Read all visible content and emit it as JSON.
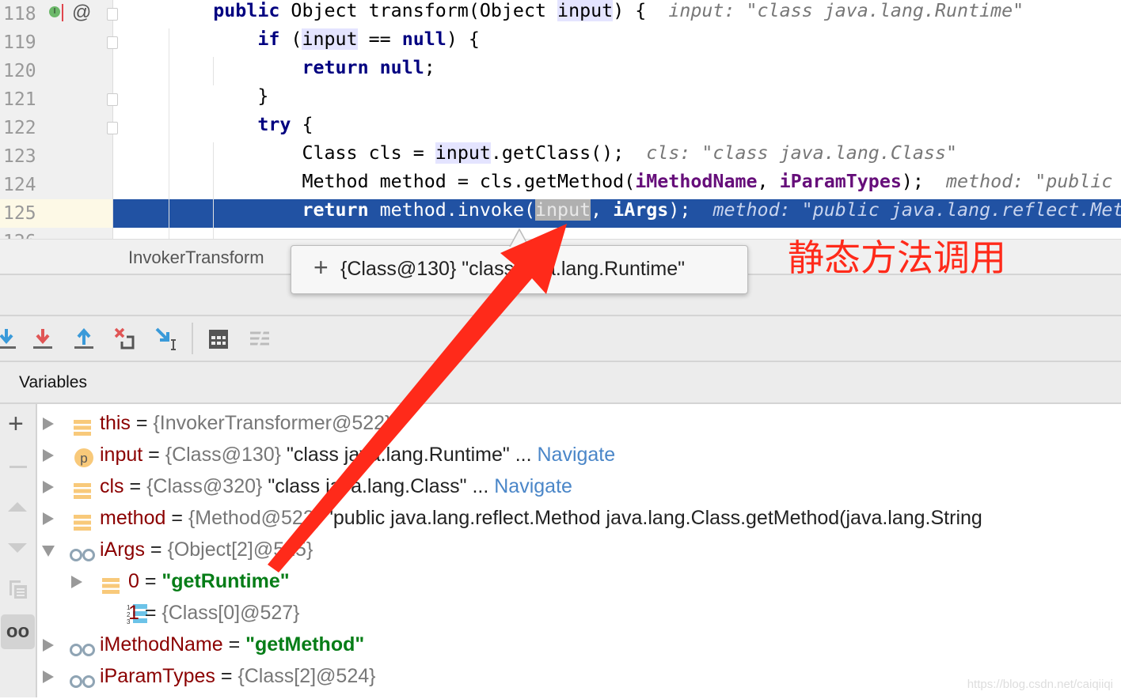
{
  "editor": {
    "lines": [
      {
        "num": "118",
        "indent": 4,
        "tokens": [
          [
            "public",
            "kw"
          ],
          [
            " Object transform(Object ",
            ""
          ],
          [
            "input",
            "hl"
          ],
          [
            ") {  ",
            ""
          ],
          [
            "input: \"class java.lang.Runtime\"",
            "hint"
          ]
        ]
      },
      {
        "num": "119",
        "indent": 8,
        "tokens": [
          [
            "if",
            "kw"
          ],
          [
            " (",
            ""
          ],
          [
            "input",
            "hl"
          ],
          [
            " == ",
            ""
          ],
          [
            "null",
            "kw"
          ],
          [
            ") {",
            ""
          ]
        ]
      },
      {
        "num": "120",
        "indent": 12,
        "tokens": [
          [
            "return",
            "kw"
          ],
          [
            " ",
            ""
          ],
          [
            "null",
            "kw"
          ],
          [
            ";",
            ""
          ]
        ]
      },
      {
        "num": "121",
        "indent": 8,
        "tokens": [
          [
            "}",
            ""
          ]
        ]
      },
      {
        "num": "122",
        "indent": 8,
        "tokens": [
          [
            "try",
            "kw"
          ],
          [
            " {",
            ""
          ]
        ]
      },
      {
        "num": "123",
        "indent": 12,
        "tokens": [
          [
            "Class cls = ",
            ""
          ],
          [
            "input",
            "hl"
          ],
          [
            ".getClass();  ",
            ""
          ],
          [
            "cls: \"class java.lang.Class\"",
            "hint"
          ]
        ]
      },
      {
        "num": "124",
        "indent": 12,
        "tokens": [
          [
            "Method method = cls.getMethod(",
            ""
          ],
          [
            "iMethodName",
            "fld"
          ],
          [
            ", ",
            ""
          ],
          [
            "iParamTypes",
            "fld"
          ],
          [
            ");  ",
            ""
          ],
          [
            "method: \"public java",
            "hint"
          ]
        ]
      },
      {
        "num": "125",
        "indent": 12,
        "current": true,
        "tokens": [
          [
            "return",
            "kw"
          ],
          [
            " method.invoke(",
            ""
          ],
          [
            "input",
            "selhl"
          ],
          [
            ", ",
            ""
          ],
          [
            "iArgs",
            "fld"
          ],
          [
            ");  ",
            ""
          ],
          [
            "method: \"public java.lang.reflect.Method ",
            "hint"
          ]
        ]
      },
      {
        "num": "126",
        "indent": 0,
        "tokens": []
      }
    ]
  },
  "tab": {
    "label": "InvokerTransform"
  },
  "tooltip": {
    "expand": "+",
    "text": "{Class@130} \"class java.lang.Runtime\""
  },
  "toolbar": {
    "icons": [
      "step-over-icon",
      "step-into-icon",
      "force-step-into-icon",
      "step-out-icon",
      "drop-frame-icon",
      "run-to-cursor-icon",
      "evaluate-expression-icon",
      "trace-icon"
    ]
  },
  "variables": {
    "title": "Variables",
    "rows": [
      {
        "depth": 0,
        "expand": "right",
        "icon": "field-icon",
        "name": "this",
        "type": "{InvokerTransformer@522}",
        "value": "",
        "navigate": ""
      },
      {
        "depth": 0,
        "expand": "right",
        "icon": "parameter-icon",
        "name": "input",
        "type": "{Class@130}",
        "value": "\"class java.lang.Runtime\" ...",
        "navigate": "Navigate"
      },
      {
        "depth": 0,
        "expand": "right",
        "icon": "field-icon",
        "name": "cls",
        "type": "{Class@320}",
        "value": "\"class java.lang.Class\" ...",
        "navigate": "Navigate"
      },
      {
        "depth": 0,
        "expand": "right",
        "icon": "field-icon",
        "name": "method",
        "type": "{Method@522}",
        "value": "\"public java.lang.reflect.Method java.lang.Class.getMethod(java.lang.String",
        "navigate": ""
      },
      {
        "depth": 0,
        "expand": "down",
        "icon": "watch-icon",
        "name": "iArgs",
        "type": "{Object[2]@525}",
        "value": "",
        "navigate": ""
      },
      {
        "depth": 1,
        "expand": "right",
        "icon": "field-icon",
        "name": "0",
        "type": "",
        "value": "",
        "str": "\"getRuntime\"",
        "navigate": ""
      },
      {
        "depth": 1,
        "expand": "",
        "icon": "array-icon",
        "name": "1",
        "type": "{Class[0]@527}",
        "value": "",
        "navigate": ""
      },
      {
        "depth": 0,
        "expand": "right",
        "icon": "watch-icon",
        "name": "iMethodName",
        "type": "",
        "value": "",
        "str": "\"getMethod\"",
        "navigate": ""
      },
      {
        "depth": 0,
        "expand": "right",
        "icon": "watch-icon",
        "name": "iParamTypes",
        "type": "{Class[2]@524}",
        "value": "",
        "navigate": ""
      }
    ]
  },
  "annotation": {
    "text": "静态方法调用",
    "color": "#ff2a1a"
  },
  "watermark": "https://blog.csdn.net/caiqiiqi",
  "colors": {
    "selection": "#2152a3",
    "keyword": "#000080",
    "field": "#660e7a",
    "string": "#067d17",
    "varname": "#8b0000",
    "link": "#4a86c8"
  }
}
